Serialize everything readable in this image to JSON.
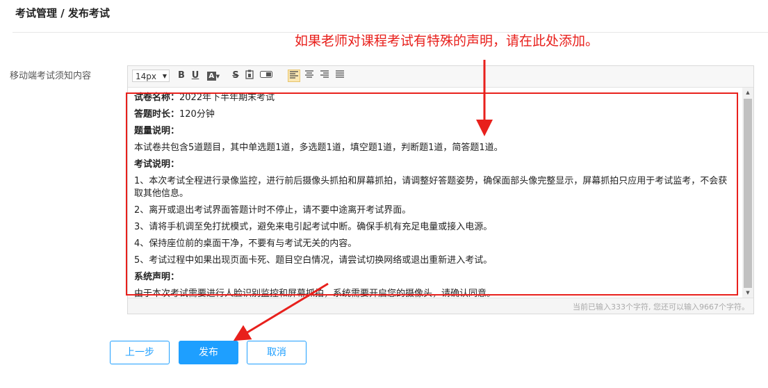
{
  "breadcrumb": "考试管理 / 发布考试",
  "annotation": "如果老师对课程考试有特殊的声明，请在此处添加。",
  "field_label": "移动端考试须知内容",
  "toolbar": {
    "font_size": "14px",
    "buttons": [
      "bold-icon",
      "underline-icon",
      "font-color-icon",
      "strikethrough-icon",
      "paste-text-icon",
      "toggle-icon",
      "align-left-icon",
      "align-center-icon",
      "align-right-icon",
      "align-justify-icon"
    ]
  },
  "content": {
    "paper_name_label": "试卷名称：",
    "paper_name_value": "2022年下半年期末考试",
    "duration_label": "答题时长：",
    "duration_value": "120分钟",
    "question_desc_label": "题量说明：",
    "question_desc_text": "本试卷共包含5道题目，其中单选题1道，多选题1道，填空题1道，判断题1道，简答题1道。",
    "exam_desc_label": "考试说明：",
    "items": [
      "1、本次考试全程进行录像监控，进行前后摄像头抓拍和屏幕抓拍，请调整好答题姿势，确保面部头像完整显示，屏幕抓拍只应用于考试监考，不会获取其他信息。",
      "2、离开或退出考试界面答题计时不停止，请不要中途离开考试界面。",
      "3、请将手机调至免打扰模式，避免来电引起考试中断。确保手机有充足电量或接入电源。",
      "4、保持座位前的桌面干净，不要有与考试无关的内容。",
      "5、考试过程中如果出现页面卡死、题目空白情况，请尝试切换网络或退出重新进入考试。"
    ],
    "system_label": "系统声明：",
    "system_text": "由于本次考试需要进行人脸识别监控和屏幕抓拍，系统需要开启您的摄像头，请确认同意。"
  },
  "char_count": "当前已输入333个字符, 您还可以输入9667个字符。",
  "buttons": {
    "prev": "上一步",
    "publish": "发布",
    "cancel": "取消"
  },
  "colors": {
    "accent": "#1e9fff",
    "annotation": "#e8201c"
  }
}
